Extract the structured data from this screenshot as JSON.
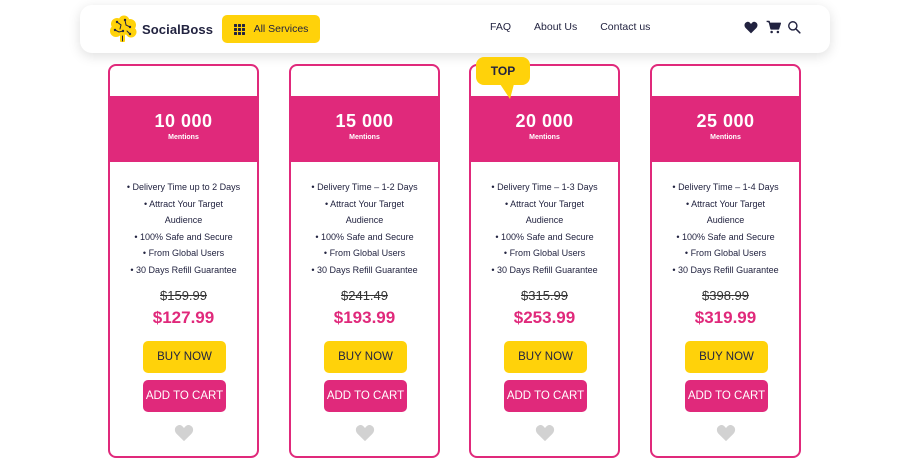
{
  "colors": {
    "brand_pink": "#E0297B",
    "accent_yellow": "#FFD20A",
    "text_dark": "#222340",
    "heart_gray": "#D2D2D2"
  },
  "header": {
    "logo_text": "SocialBoss",
    "logo_icon": "brain-icon",
    "services_label": "All Services",
    "nav": [
      "FAQ",
      "About Us",
      "Contact us"
    ],
    "icons": [
      "heart-icon",
      "cart-icon",
      "search-icon"
    ]
  },
  "badge": {
    "label": "TOP"
  },
  "cards": [
    {
      "quantity": "10 000",
      "unit": "Mentions",
      "features": [
        "Delivery Time up to 2 Days",
        "Attract Your Target",
        "Audience",
        "100% Safe and Secure",
        "From Global Users",
        "30 Days Refill Guarantee"
      ],
      "old_price": "$159.99",
      "new_price": "$127.99",
      "buy_label": "BUY NOW",
      "cart_label": "ADD TO CART"
    },
    {
      "quantity": "15 000",
      "unit": "Mentions",
      "features": [
        "Delivery Time – 1-2 Days",
        "Attract Your Target",
        "Audience",
        "100% Safe and Secure",
        "From Global Users",
        "30 Days Refill Guarantee"
      ],
      "old_price": "$241.49",
      "new_price": "$193.99",
      "buy_label": "BUY NOW",
      "cart_label": "ADD TO CART"
    },
    {
      "quantity": "20 000",
      "unit": "Mentions",
      "features": [
        "Delivery Time – 1-3 Days",
        "Attract Your Target",
        "Audience",
        "100% Safe and Secure",
        "From Global Users",
        "30 Days Refill Guarantee"
      ],
      "old_price": "$315.99",
      "new_price": "$253.99",
      "buy_label": "BUY NOW",
      "cart_label": "ADD TO CART"
    },
    {
      "quantity": "25 000",
      "unit": "Mentions",
      "features": [
        "Delivery Time – 1-4 Days",
        "Attract Your Target",
        "Audience",
        "100% Safe and Secure",
        "From Global Users",
        "30 Days Refill Guarantee"
      ],
      "old_price": "$398.99",
      "new_price": "$319.99",
      "buy_label": "BUY NOW",
      "cart_label": "ADD TO CART"
    }
  ]
}
